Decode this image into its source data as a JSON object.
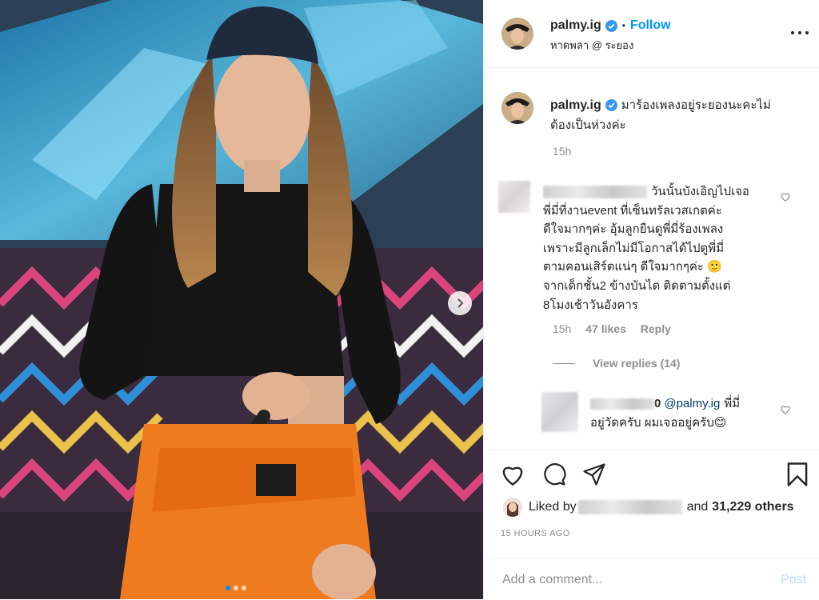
{
  "header": {
    "username": "palmy.ig",
    "dot": "•",
    "follow": "Follow",
    "location": "หาดพลา @ ระยอง",
    "more": "•••"
  },
  "caption": {
    "username": "palmy.ig",
    "text_line1": "มาร้องเพลงอยู่ระยองนะคะไม่",
    "text_line2": "ต้องเป็นห่วงค่ะ",
    "time": "15h"
  },
  "comments": [
    {
      "text_line1": "วันนั้นบังเอิญไปเจอ",
      "text_line2": "พี่มี่ที่งานevent ที่เซ็นทรัลเวสเกตค่ะ",
      "text_line3": "ดีใจมากๆค่ะ อุ้มลูกยืนดูพี่มี่ร้องเพลง",
      "text_line4": "เพราะมีลูกเล็กไม่มีโอกาสได้ไปดูพี่มี่",
      "text_line5": "ตามคอนเสิร์ตแน่ๆ ดีใจมากๆค่ะ 🙂",
      "text_line6": "จากเด็กชั้น2 ข้างบันได ติดตามตั้งแต่",
      "text_line7": "8โมงเช้าวันอังคาร",
      "time": "15h",
      "likes": "47 likes",
      "reply": "Reply",
      "view_replies": "View replies (14)"
    },
    {
      "username_tail": "0",
      "mention": "@palmy.ig",
      "text_line1": "พี่มี่",
      "text_line2": "อยู่วัดครับ ผมเจออยู่ครับ😊"
    }
  ],
  "likes": {
    "prefix": "Liked by",
    "and_text": "and",
    "count": "31,229 others"
  },
  "timestamp": "15 HOURS AGO",
  "composer": {
    "placeholder": "Add a comment...",
    "post": "Post"
  },
  "colors": {
    "accent": "#0095f6",
    "muted": "#8e8e8e",
    "orange": "#f07a1e"
  }
}
